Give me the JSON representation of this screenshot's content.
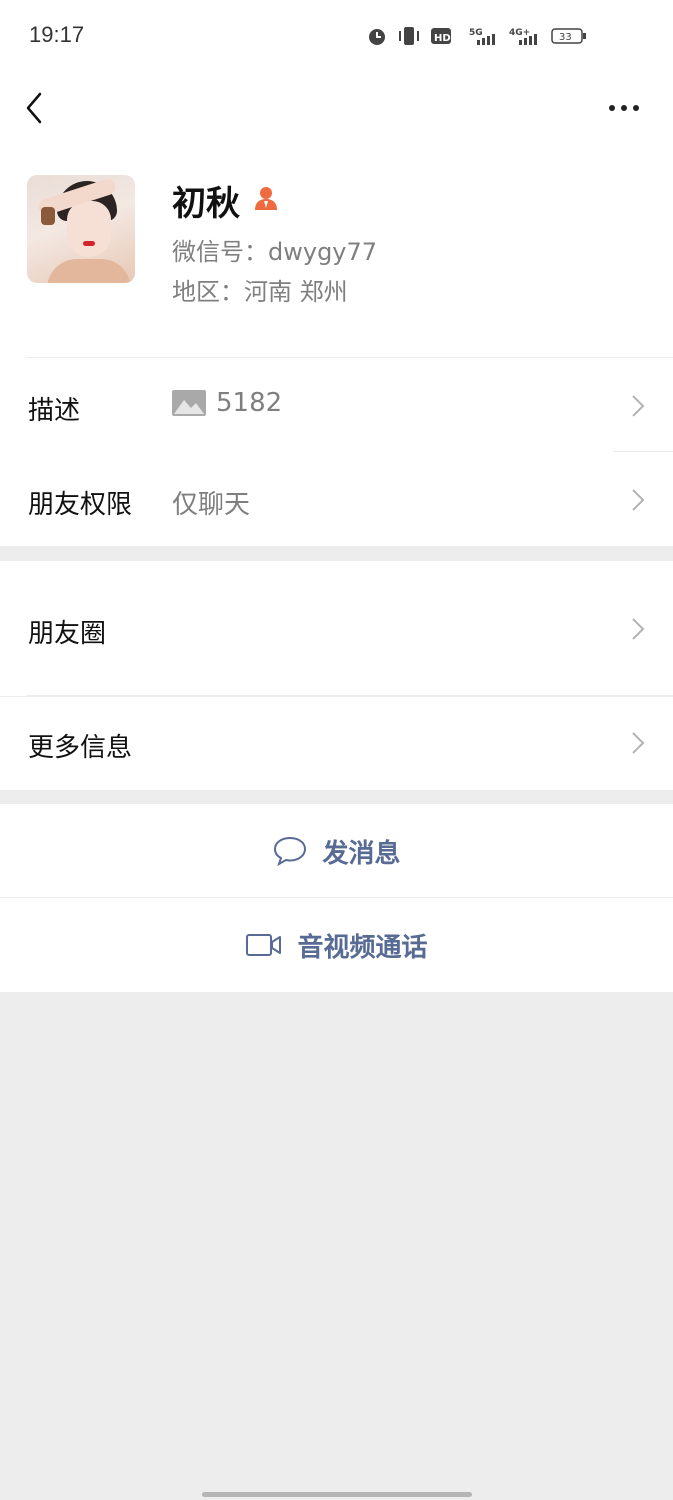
{
  "status_bar": {
    "time": "19:17",
    "icons": [
      "alarm-icon",
      "vibrate-icon",
      "hd-icon",
      "5g-signal-icon",
      "4g-signal-icon",
      "battery-icon"
    ],
    "battery_level": "33"
  },
  "nav": {
    "back_icon": "chevron-left-icon",
    "more_icon": "more-dots-icon"
  },
  "profile": {
    "nickname": "初秋",
    "wechat_id": "微信号：dwygy77",
    "region": "地区：河南  郑州",
    "badge_icon": "person-badge-icon",
    "badge_color": "#f06a40"
  },
  "rows": {
    "description_label": "描述",
    "description_value": "5182",
    "permission_label": "朋友权限",
    "permission_value": "仅聊天",
    "moments_label": "朋友圈",
    "more_info_label": "更多信息"
  },
  "actions": {
    "message_label": "发消息",
    "call_label": "音视频通话",
    "accent": "#576b95"
  }
}
